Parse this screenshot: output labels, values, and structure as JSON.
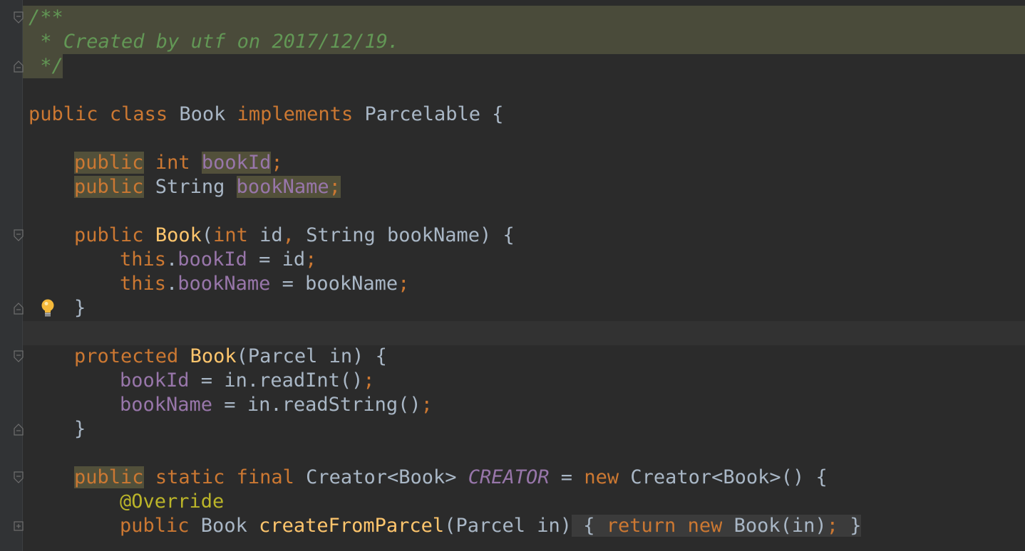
{
  "editor": {
    "language": "Java",
    "theme_colors": {
      "background": "#2b2b2b",
      "keyword": "#cc7832",
      "field": "#9876aa",
      "method": "#ffc66d",
      "comment": "#629755",
      "annotation": "#bbb529",
      "text": "#a9b7c6"
    },
    "lines": {
      "l1": "/**",
      "l2": " * Created by utf on 2017/12/19.",
      "l3": " */",
      "l5": {
        "t1": "public",
        "t2": " ",
        "t3": "class",
        "t4": " Book ",
        "t5": "implements",
        "t6": " Parcelable {"
      },
      "l7": {
        "t1": "public",
        "t2": " ",
        "t3": "int",
        "t4": " ",
        "t5": "bookId",
        "t6": ";"
      },
      "l8": {
        "t1": "public",
        "t2": " String ",
        "t3": "bookName",
        "t4": ";"
      },
      "l10": {
        "t1": "public",
        "t2": " ",
        "t3": "Book",
        "t4": "(",
        "t5": "int",
        "t6": " id",
        "t7": ",",
        "t8": " String bookName) {"
      },
      "l11": {
        "t1": "this",
        "t2": ".",
        "t3": "bookId",
        "t4": " = id",
        "t5": ";"
      },
      "l12": {
        "t1": "this",
        "t2": ".",
        "t3": "bookName",
        "t4": " = bookName",
        "t5": ";"
      },
      "l13": "}",
      "l15": {
        "t1": "protected",
        "t2": " ",
        "t3": "Book",
        "t4": "(Parcel in) {"
      },
      "l16": {
        "t1": "bookId",
        "t2": " = in.readInt()",
        "t3": ";"
      },
      "l17": {
        "t1": "bookName",
        "t2": " = in.readString()",
        "t3": ";"
      },
      "l18": "}",
      "l20": {
        "t1": "public",
        "t2": " ",
        "t3": "static",
        "t4": " ",
        "t5": "final",
        "t6": " Creator<Book> ",
        "t7": "CREATOR",
        "t8": " = ",
        "t9": "new",
        "t10": " Creator<Book>() {"
      },
      "l21": "@Override",
      "l22": {
        "t1": "public",
        "t2": " Book ",
        "t3": "createFromParcel",
        "t4": "(Parcel in)",
        "t5": " { ",
        "t6": "return",
        "t7": " ",
        "t8": "new",
        "t9": " Book(in)",
        "t10": ";",
        "t11": " }"
      }
    },
    "gutter_icons": [
      "fold-open-icon",
      "fold-close-icon",
      "lightbulb-icon",
      "fold-expand-icon"
    ]
  }
}
